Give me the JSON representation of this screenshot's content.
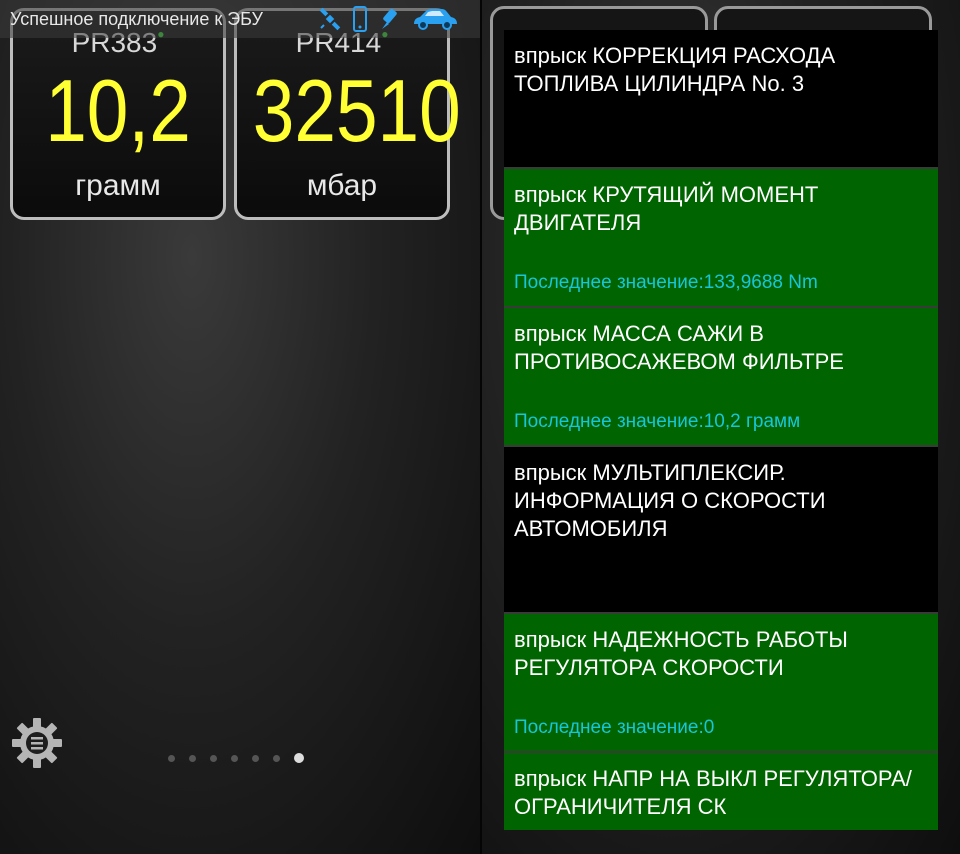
{
  "status": {
    "text": "Успешное подключение к ЭБУ",
    "icons": [
      "satellite-icon",
      "phone-icon",
      "bluetooth-adapter-icon",
      "car-icon"
    ],
    "icon_color": "#2aa0f0"
  },
  "gauges": [
    {
      "code": "PR383",
      "value": "10,2",
      "unit": "грамм"
    },
    {
      "code": "PR414",
      "value": "32510",
      "unit": "мбар"
    }
  ],
  "pager": {
    "count": 7,
    "active_index": 6
  },
  "colors": {
    "value_yellow": "#ffff33",
    "list_green": "#006400",
    "last_value_cyan": "#19c5d8"
  },
  "list": {
    "items": [
      {
        "title": "впрыск КОРРЕКЦИЯ РАСХОДА ТОПЛИВА ЦИЛИНДРА No. 3",
        "last": "",
        "style": "black"
      },
      {
        "title": "впрыск КРУТЯЩИЙ МОМЕНТ ДВИГАТЕЛЯ",
        "last": "Последнее значение:133,9688 Nm",
        "style": "green"
      },
      {
        "title": "впрыск МАССА САЖИ В ПРОТИВОСАЖЕВОМ ФИЛЬТРЕ",
        "last": "Последнее значение:10,2 грамм",
        "style": "green"
      },
      {
        "title": "впрыск МУЛЬТИПЛЕКСИР. ИНФОРМАЦИЯ О СКОРОСТИ АВТОМОБИЛЯ",
        "last": "",
        "style": "black"
      },
      {
        "title": "впрыск НАДЕЖНОСТЬ РАБОТЫ РЕГУЛЯТОРА СКОРОСТИ",
        "last": "Последнее значение:0",
        "style": "green"
      },
      {
        "title": "впрыск НАПР НА ВЫКЛ РЕГУЛЯТОРА/ОГРАНИЧИТЕЛЯ СК",
        "last": "",
        "style": "green"
      }
    ]
  }
}
